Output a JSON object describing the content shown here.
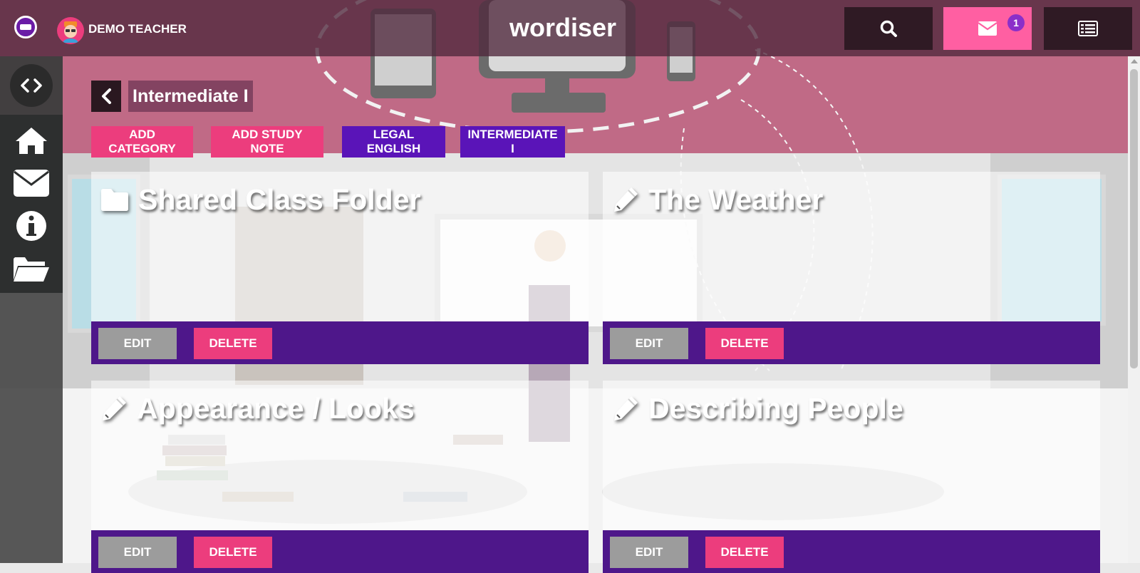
{
  "header": {
    "user_name": "DEMO TEACHER",
    "brand": "wordiser",
    "mail_badge": "1",
    "icons": [
      "app-logo-icon",
      "teacher-avatar-icon",
      "search-icon",
      "mail-icon",
      "list-icon"
    ]
  },
  "sidebar": {
    "items": [
      {
        "icon": "home-icon"
      },
      {
        "icon": "mail-icon"
      },
      {
        "icon": "info-icon"
      },
      {
        "icon": "folder-open-icon"
      }
    ]
  },
  "page": {
    "title": "Intermediate I"
  },
  "actions": {
    "add_category": "ADD CATEGORY",
    "add_study_note": "ADD STUDY NOTE",
    "legal_english": "LEGAL ENGLISH",
    "intermediate": "INTERMEDIATE I"
  },
  "cards": [
    {
      "title": "Shared Class Folder",
      "icon": "folder-icon",
      "edit": "EDIT",
      "delete": "DELETE"
    },
    {
      "title": "The Weather",
      "icon": "pencil-icon",
      "edit": "EDIT",
      "delete": "DELETE"
    },
    {
      "title": "Appearance / Looks",
      "icon": "pencil-icon",
      "edit": "EDIT",
      "delete": "DELETE"
    },
    {
      "title": "Describing People",
      "icon": "pencil-icon",
      "edit": "EDIT",
      "delete": "DELETE"
    }
  ],
  "colors": {
    "pink": "#ec3d7d",
    "purple": "#5a14b8",
    "card_footer": "#4e178a",
    "topbar": "#50283c",
    "mail_button": "#ff5fa2"
  }
}
